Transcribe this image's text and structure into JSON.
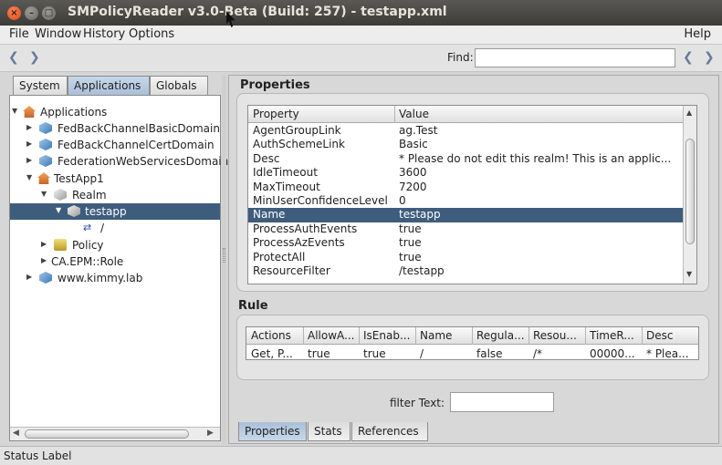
{
  "window": {
    "title": "SMPolicyReader v3.0-Beta (Build: 257) - testapp.xml",
    "close_glyph": "×",
    "min_glyph": "–",
    "max_glyph": "□"
  },
  "menu": {
    "file": "File",
    "window": "Window",
    "history": "History",
    "options": "Options",
    "help": "Help"
  },
  "toolbar": {
    "back_glyph": "❮",
    "forward_glyph": "❯",
    "find_label": "Find:",
    "find_value": "",
    "find_prev_glyph": "❮",
    "find_next_glyph": "❯"
  },
  "left_tabs": [
    {
      "label": "System"
    },
    {
      "label": "Applications"
    },
    {
      "label": "Globals"
    }
  ],
  "tree": [
    {
      "label": "Applications",
      "toggle": "▼",
      "icon": "house-icon"
    },
    {
      "label": "FedBackChannelBasicDomain",
      "toggle": "▶",
      "icon": "domain-cube-icon"
    },
    {
      "label": "FedBackChannelCertDomain",
      "toggle": "▶",
      "icon": "domain-cube-icon"
    },
    {
      "label": "FederationWebServicesDomain",
      "toggle": "▶",
      "icon": "domain-cube-icon"
    },
    {
      "label": "TestApp1",
      "toggle": "▼",
      "icon": "house-icon"
    },
    {
      "label": "Realm",
      "toggle": "▼",
      "icon": "realm-cube-icon"
    },
    {
      "label": "testapp",
      "toggle": "▼",
      "icon": "realm-cube-icon"
    },
    {
      "label": "/",
      "toggle": "",
      "icon": "resource-arrows-icon",
      "glyph": "⇄"
    },
    {
      "label": "Policy",
      "toggle": "▶",
      "icon": "policy-icon"
    },
    {
      "label": "CA.EPM::Role",
      "toggle": "▶",
      "icon": ""
    },
    {
      "label": "www.kimmy.lab",
      "toggle": "▶",
      "icon": "domain-cube-icon"
    }
  ],
  "properties": {
    "section_title": "Properties",
    "col_property": "Property",
    "col_value": "Value",
    "rows": [
      {
        "property": "AgentGroupLink",
        "value": "ag.Test"
      },
      {
        "property": "AuthSchemeLink",
        "value": "Basic"
      },
      {
        "property": "Desc",
        "value": "* Please do not edit this realm! This is an applic..."
      },
      {
        "property": "IdleTimeout",
        "value": "3600"
      },
      {
        "property": "MaxTimeout",
        "value": "7200"
      },
      {
        "property": "MinUserConfidenceLevel",
        "value": "0"
      },
      {
        "property": "Name",
        "value": "testapp"
      },
      {
        "property": "ProcessAuthEvents",
        "value": "true"
      },
      {
        "property": "ProcessAzEvents",
        "value": "true"
      },
      {
        "property": "ProtectAll",
        "value": "true"
      },
      {
        "property": "ResourceFilter",
        "value": "/testapp"
      }
    ]
  },
  "rule": {
    "section_title": "Rule",
    "headers": [
      "Actions",
      "AllowA...",
      "IsEnab...",
      "Name",
      "Regula...",
      "Resou...",
      "TimeR...",
      "Desc"
    ],
    "row": [
      "Get, P...",
      "true",
      "true",
      "/",
      "false",
      "/*",
      "00000...",
      "* Plea..."
    ]
  },
  "filter": {
    "label": "filter Text:",
    "value": ""
  },
  "bottom_tabs": [
    {
      "label": "Properties"
    },
    {
      "label": "Stats"
    },
    {
      "label": "References"
    }
  ],
  "status": {
    "label": "Status Label"
  },
  "scroll": {
    "left": "◀",
    "right": "▶",
    "up": "▲",
    "down": "▼"
  }
}
